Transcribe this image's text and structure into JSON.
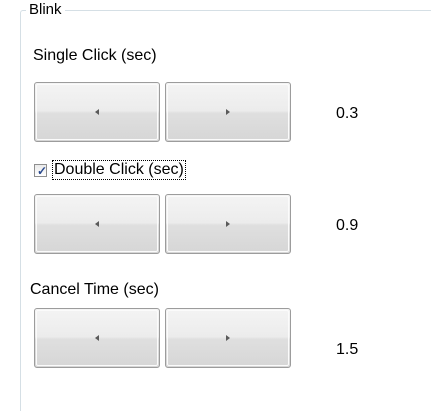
{
  "group": {
    "title": "Blink"
  },
  "single_click": {
    "label": "Single Click (sec)",
    "value": "0.3",
    "decrease_icon": "arrow-left-icon",
    "increase_icon": "arrow-right-icon"
  },
  "double_click": {
    "label": "Double Click (sec)",
    "checked": true,
    "value": "0.9",
    "decrease_icon": "arrow-left-icon",
    "increase_icon": "arrow-right-icon"
  },
  "cancel_time": {
    "label": "Cancel Time (sec)",
    "value": "1.5",
    "decrease_icon": "arrow-left-icon",
    "increase_icon": "arrow-right-icon"
  },
  "colors": {
    "group_border": "#d5dfe5",
    "button_border": "#9c9c9c",
    "checkmark": "#2a4a8e"
  }
}
